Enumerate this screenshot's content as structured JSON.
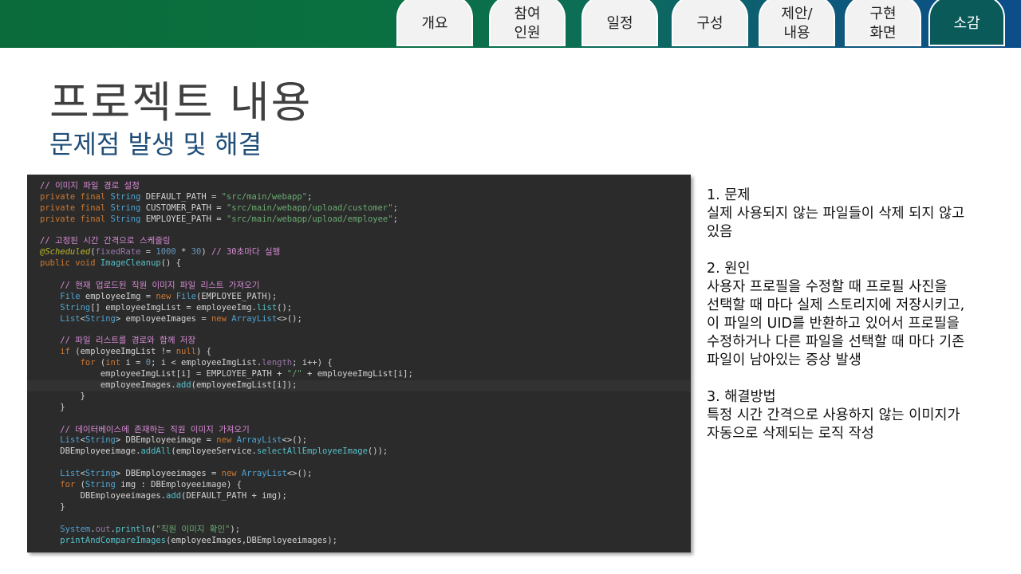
{
  "tabs": [
    {
      "label": "개요",
      "active": false
    },
    {
      "label": "참여\n인원",
      "active": false
    },
    {
      "label": "일정",
      "active": false
    },
    {
      "label": "구성",
      "active": false
    },
    {
      "label": "제안/\n내용",
      "active": false
    },
    {
      "label": "구현\n화면",
      "active": false
    },
    {
      "label": "소감",
      "active": true
    }
  ],
  "page": {
    "title": "프로젝트 내용",
    "subtitle": "문제점 발생 및 해결"
  },
  "code": {
    "lines": [
      [
        [
          "cm",
          "// 이미지 파일 경로 설정"
        ]
      ],
      [
        [
          "kw",
          "private final "
        ],
        [
          "ty",
          "String "
        ],
        [
          "plain",
          "DEFAULT_PATH = "
        ],
        [
          "str",
          "\"src/main/webapp\""
        ],
        [
          "plain",
          ";"
        ]
      ],
      [
        [
          "kw",
          "private final "
        ],
        [
          "ty",
          "String "
        ],
        [
          "plain",
          "CUSTOMER_PATH = "
        ],
        [
          "str",
          "\"src/main/webapp/upload/customer\""
        ],
        [
          "plain",
          ";"
        ]
      ],
      [
        [
          "kw",
          "private final "
        ],
        [
          "ty",
          "String "
        ],
        [
          "plain",
          "EMPLOYEE_PATH = "
        ],
        [
          "str",
          "\"src/main/webapp/upload/employee\""
        ],
        [
          "plain",
          ";"
        ]
      ],
      [],
      [
        [
          "cm",
          "// 고정된 시간 간격으로 스케줄링"
        ]
      ],
      [
        [
          "ann",
          "@Scheduled"
        ],
        [
          "plain",
          "("
        ],
        [
          "fld",
          "fixedRate"
        ],
        [
          "plain",
          " = "
        ],
        [
          "num",
          "1000"
        ],
        [
          "plain",
          " * "
        ],
        [
          "num",
          "30"
        ],
        [
          "plain",
          ") "
        ],
        [
          "cm",
          "// 30초마다 실행"
        ]
      ],
      [
        [
          "kw",
          "public void "
        ],
        [
          "mth",
          "ImageCleanup"
        ],
        [
          "plain",
          "() {"
        ]
      ],
      [],
      [
        [
          "plain",
          "    "
        ],
        [
          "cm",
          "// 현재 업로드된 직원 이미지 파일 리스트 가져오기"
        ]
      ],
      [
        [
          "plain",
          "    "
        ],
        [
          "ty",
          "File "
        ],
        [
          "plain",
          "employeeImg = "
        ],
        [
          "kw",
          "new "
        ],
        [
          "ty",
          "File"
        ],
        [
          "plain",
          "(EMPLOYEE_PATH);"
        ]
      ],
      [
        [
          "plain",
          "    "
        ],
        [
          "ty",
          "String"
        ],
        [
          "plain",
          "[] employeeImgList = employeeImg."
        ],
        [
          "mth",
          "list"
        ],
        [
          "plain",
          "();"
        ]
      ],
      [
        [
          "plain",
          "    "
        ],
        [
          "ty",
          "List"
        ],
        [
          "plain",
          "<"
        ],
        [
          "ty",
          "String"
        ],
        [
          "plain",
          "> employeeImages = "
        ],
        [
          "kw",
          "new "
        ],
        [
          "ty",
          "ArrayList"
        ],
        [
          "plain",
          "<>();"
        ]
      ],
      [],
      [
        [
          "plain",
          "    "
        ],
        [
          "cm",
          "// 파일 리스트를 경로와 함께 저장"
        ]
      ],
      [
        [
          "plain",
          "    "
        ],
        [
          "kw",
          "if "
        ],
        [
          "plain",
          "(employeeImgList != "
        ],
        [
          "kw",
          "null"
        ],
        [
          "plain",
          ") {"
        ]
      ],
      [
        [
          "plain",
          "        "
        ],
        [
          "kw",
          "for "
        ],
        [
          "plain",
          "("
        ],
        [
          "kw",
          "int "
        ],
        [
          "plain",
          "i = "
        ],
        [
          "num",
          "0"
        ],
        [
          "plain",
          "; i < employeeImgList."
        ],
        [
          "fld",
          "length"
        ],
        [
          "plain",
          "; i++) {"
        ]
      ],
      [
        [
          "plain",
          "            employeeImgList[i] = EMPLOYEE_PATH + "
        ],
        [
          "str",
          "\"/\""
        ],
        [
          "plain",
          " + employeeImgList[i];"
        ]
      ],
      [
        [
          "plain",
          "            employeeImages."
        ],
        [
          "mth",
          "add"
        ],
        [
          "plain",
          "(employeeImgList[i]);"
        ]
      ],
      [
        [
          "plain",
          "        }"
        ]
      ],
      [
        [
          "plain",
          "    }"
        ]
      ],
      [],
      [
        [
          "plain",
          "    "
        ],
        [
          "cm",
          "// 데이터베이스에 존재하는 직원 이미지 가져오기"
        ]
      ],
      [
        [
          "plain",
          "    "
        ],
        [
          "ty",
          "List"
        ],
        [
          "plain",
          "<"
        ],
        [
          "ty",
          "String"
        ],
        [
          "plain",
          "> DBEmployeeimage = "
        ],
        [
          "kw",
          "new "
        ],
        [
          "ty",
          "ArrayList"
        ],
        [
          "plain",
          "<>();"
        ]
      ],
      [
        [
          "plain",
          "    DBEmployeeimage."
        ],
        [
          "mth",
          "addAll"
        ],
        [
          "plain",
          "(employeeService."
        ],
        [
          "mth",
          "selectAllEmployeeImage"
        ],
        [
          "plain",
          "());"
        ]
      ],
      [],
      [
        [
          "plain",
          "    "
        ],
        [
          "ty",
          "List"
        ],
        [
          "plain",
          "<"
        ],
        [
          "ty",
          "String"
        ],
        [
          "plain",
          "> DBEmployeeimages = "
        ],
        [
          "kw",
          "new "
        ],
        [
          "ty",
          "ArrayList"
        ],
        [
          "plain",
          "<>();"
        ]
      ],
      [
        [
          "plain",
          "    "
        ],
        [
          "kw",
          "for "
        ],
        [
          "plain",
          "("
        ],
        [
          "ty",
          "String "
        ],
        [
          "plain",
          "img : DBEmployeeimage) {"
        ]
      ],
      [
        [
          "plain",
          "        DBEmployeeimages."
        ],
        [
          "mth",
          "add"
        ],
        [
          "plain",
          "(DEFAULT_PATH + img);"
        ]
      ],
      [
        [
          "plain",
          "    }"
        ]
      ],
      [],
      [
        [
          "plain",
          "    "
        ],
        [
          "ty",
          "System"
        ],
        [
          "plain",
          "."
        ],
        [
          "fld",
          "out"
        ],
        [
          "plain",
          "."
        ],
        [
          "mth",
          "println"
        ],
        [
          "plain",
          "("
        ],
        [
          "str",
          "\"직원 이미지 확인\""
        ],
        [
          "plain",
          ");"
        ]
      ],
      [
        [
          "plain",
          "    "
        ],
        [
          "mth",
          "printAndCompareImages"
        ],
        [
          "plain",
          "(employeeImages,DBEmployeeimages);"
        ]
      ]
    ],
    "highlight_line": 18
  },
  "notes": [
    {
      "heading": "1. 문제",
      "body": "실제 사용되지 않는 파일들이 삭제 되지 않고\n있음"
    },
    {
      "heading": "2. 원인",
      "body": "사용자 프로필을 수정할 때 프로필 사진을\n선택할 때 마다 실제 스토리지에 저장시키고,\n이 파일의 UID를 반환하고 있어서 프로필을\n수정하거나 다른 파일을 선택할 때 마다 기존\n파일이 남아있는 증상 발생"
    },
    {
      "heading": "3. 해결방법",
      "body": "특정 시간 간격으로 사용하지 않는 이미지가\n자동으로 삭제되는 로직 작성"
    }
  ]
}
